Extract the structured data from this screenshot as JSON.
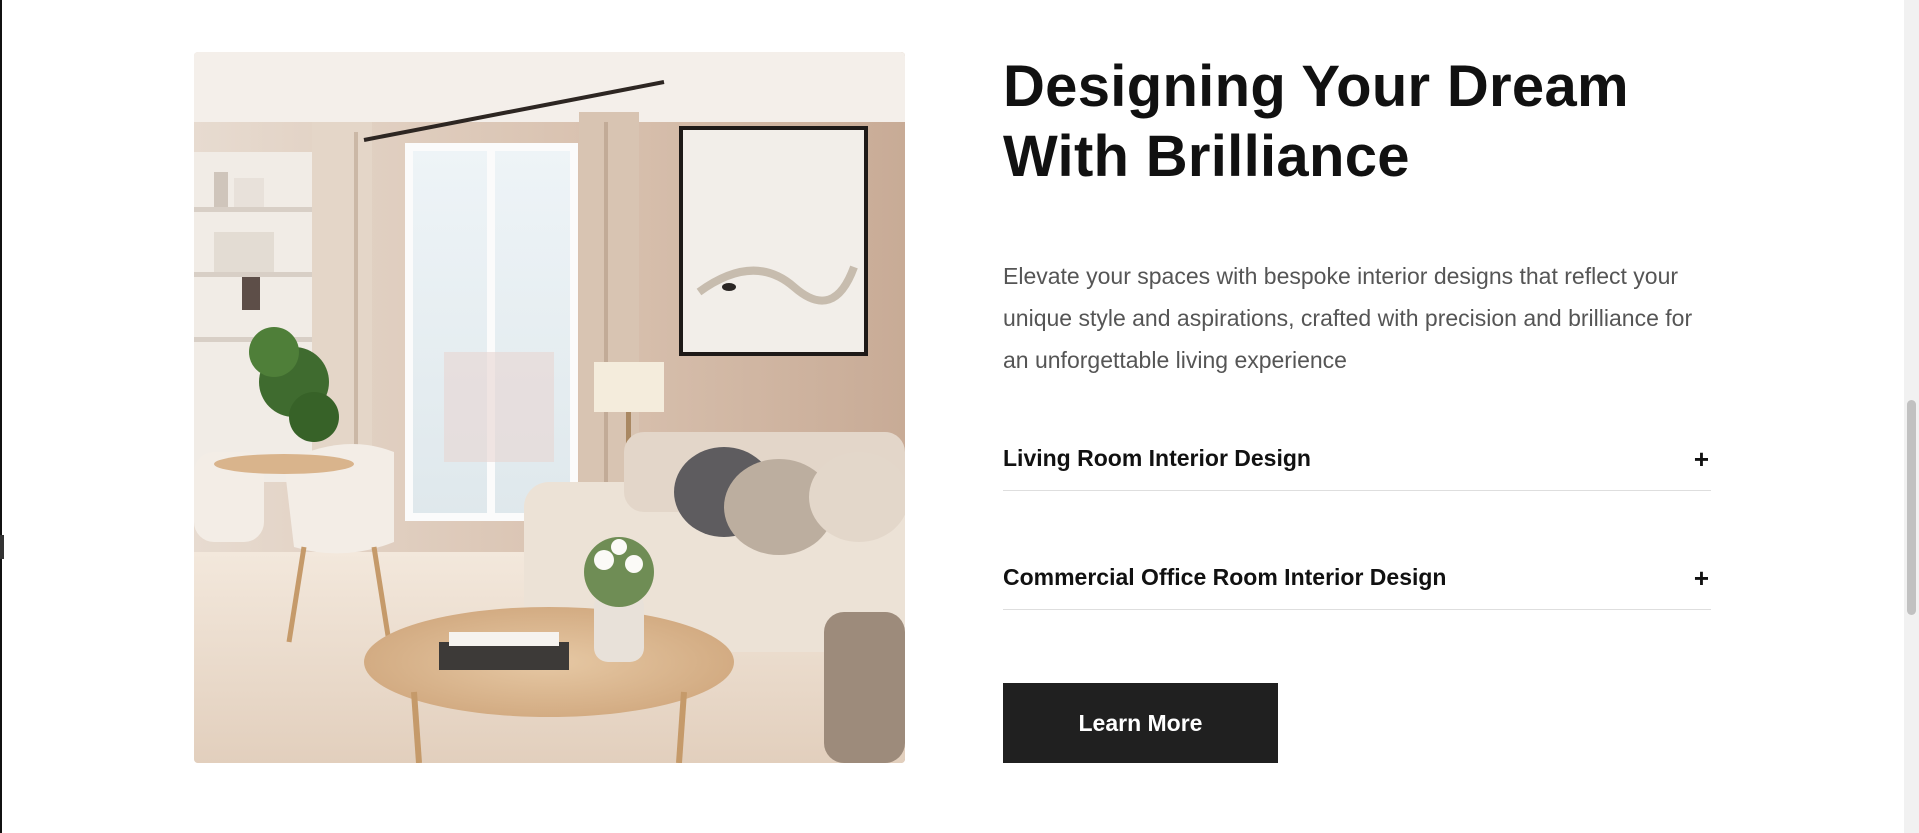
{
  "section": {
    "title": "Designing Your Dream\nWith Brilliance",
    "description": "Elevate your spaces with bespoke interior designs that reflect your unique style and aspirations, crafted with precision and brilliance for an unforgettable living experience",
    "accordion": [
      {
        "label": "Living Room Interior Design",
        "icon": "plus-icon",
        "toggle": "+"
      },
      {
        "label": "Commercial Office Room Interior Design",
        "icon": "plus-icon",
        "toggle": "+"
      }
    ],
    "cta_label": "Learn More",
    "image": {
      "subject": "interior-living-room-photo"
    }
  },
  "colors": {
    "background": "#ffffff",
    "heading": "#111111",
    "body_text": "#555555",
    "divider": "#dedede",
    "button_bg": "#202020",
    "button_text": "#ffffff"
  }
}
